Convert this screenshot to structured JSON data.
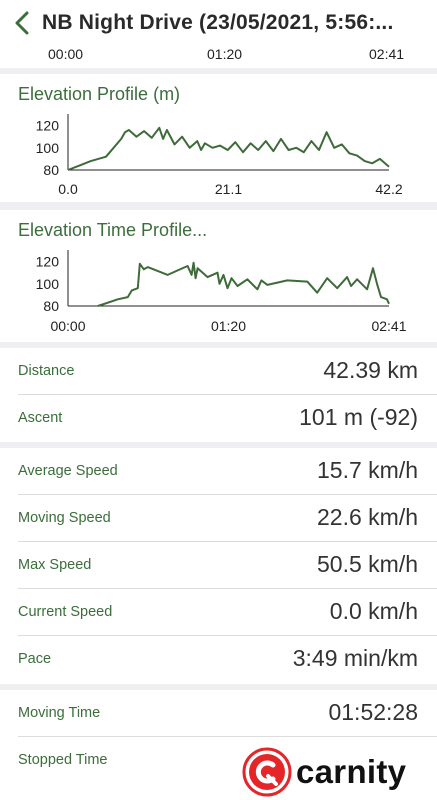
{
  "header": {
    "back_icon": "chevron-left-icon",
    "title": "NB Night Drive  (23/05/2021, 5:56:..."
  },
  "top_axis": {
    "ticks": [
      "00:00",
      "01:20",
      "02:41"
    ]
  },
  "colors": {
    "accent": "#3b6e3b",
    "line": "#3f6b3a",
    "brand_red": "#e42629"
  },
  "chart_data": [
    {
      "type": "line",
      "title": "Elevation Profile (m)",
      "x_ticks": [
        "0.0",
        "21.1",
        "42.2"
      ],
      "y_ticks": [
        "120",
        "100",
        "80"
      ],
      "ylim": [
        80,
        125
      ],
      "xlim": [
        0,
        42.2
      ],
      "grid": false,
      "x": [
        0,
        1.5,
        3,
        5,
        6,
        7,
        7.5,
        8,
        9,
        10,
        11,
        12,
        12.5,
        13,
        14,
        15,
        16,
        17,
        17.5,
        18,
        19,
        20,
        21,
        22,
        23,
        24,
        25,
        26,
        27,
        28,
        29,
        30,
        31,
        32,
        33,
        34,
        35,
        36,
        37,
        38,
        39,
        40,
        41,
        42.2
      ],
      "values": [
        80,
        84,
        88,
        92,
        100,
        108,
        114,
        116,
        110,
        115,
        109,
        118,
        108,
        116,
        103,
        110,
        100,
        106,
        98,
        104,
        100,
        102,
        98,
        105,
        96,
        104,
        98,
        106,
        97,
        108,
        98,
        100,
        96,
        106,
        98,
        114,
        100,
        103,
        95,
        93,
        88,
        86,
        90,
        83
      ]
    },
    {
      "type": "line",
      "title": "Elevation Time Profile...",
      "x_ticks": [
        "00:00",
        "01:20",
        "02:41"
      ],
      "y_ticks": [
        "120",
        "100",
        "80"
      ],
      "ylim": [
        80,
        125
      ],
      "xlim": [
        0,
        161
      ],
      "grid": false,
      "x": [
        15,
        25,
        30,
        32,
        35,
        36,
        38,
        40,
        50,
        55,
        60,
        62,
        63,
        64,
        65,
        70,
        75,
        76,
        78,
        80,
        82,
        85,
        90,
        95,
        97,
        100,
        110,
        120,
        125,
        130,
        135,
        140,
        142,
        145,
        150,
        153,
        155,
        157,
        160,
        161
      ],
      "values": [
        80,
        86,
        88,
        94,
        96,
        118,
        113,
        115,
        108,
        112,
        116,
        108,
        119,
        105,
        114,
        106,
        110,
        100,
        108,
        96,
        105,
        98,
        104,
        95,
        103,
        99,
        103,
        102,
        92,
        105,
        96,
        106,
        98,
        104,
        95,
        114,
        100,
        88,
        86,
        82
      ]
    }
  ],
  "stats_group1": [
    {
      "label": "Distance",
      "value": "42.39 km"
    },
    {
      "label": "Ascent",
      "value": "101 m (-92)"
    }
  ],
  "stats_group2": [
    {
      "label": "Average Speed",
      "value": "15.7 km/h"
    },
    {
      "label": "Moving Speed",
      "value": "22.6 km/h"
    },
    {
      "label": "Max Speed",
      "value": "50.5 km/h"
    },
    {
      "label": "Current Speed",
      "value": "0.0 km/h"
    },
    {
      "label": "Pace",
      "value": "3:49 min/km"
    }
  ],
  "stats_group3": [
    {
      "label": "Moving Time",
      "value": "01:52:28"
    },
    {
      "label": "Stopped Time",
      "value": ""
    }
  ],
  "brand": {
    "wordmark": "carnity",
    "icon": "carnity-logo-icon"
  }
}
